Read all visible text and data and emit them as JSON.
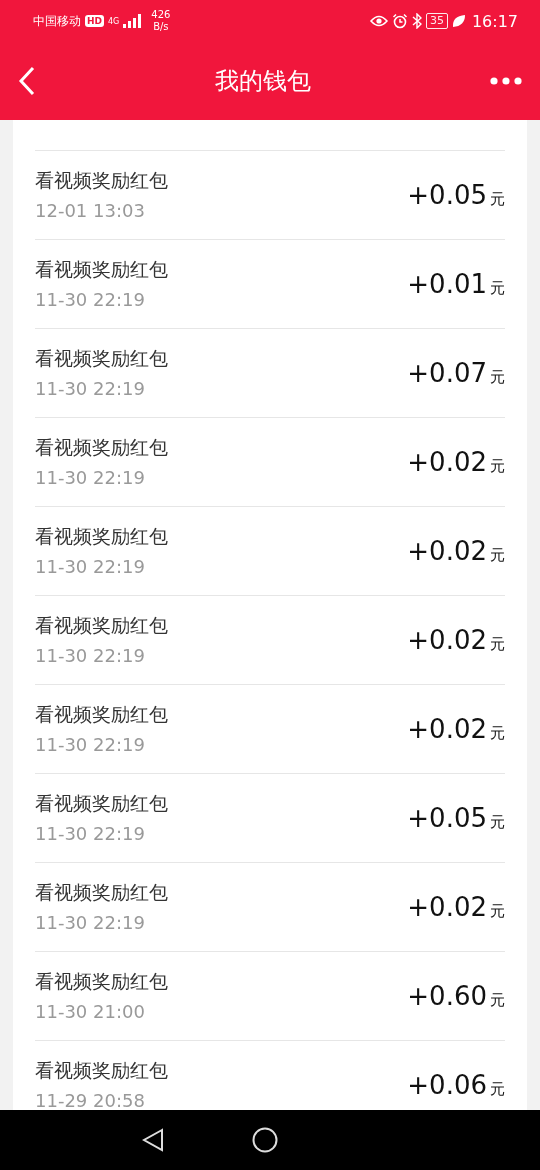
{
  "status_bar": {
    "carrier": "中国移动",
    "hd_badge": "HD",
    "network_type": "4G",
    "speed": "426",
    "speed_unit": "B/s",
    "battery": "35",
    "time": "16:17"
  },
  "header": {
    "title": "我的钱包"
  },
  "transactions": [
    {
      "title": "看视频奖励红包",
      "date": "12-01 13:03",
      "amount": "+0.05",
      "unit": "元"
    },
    {
      "title": "看视频奖励红包",
      "date": "11-30 22:19",
      "amount": "+0.01",
      "unit": "元"
    },
    {
      "title": "看视频奖励红包",
      "date": "11-30 22:19",
      "amount": "+0.07",
      "unit": "元"
    },
    {
      "title": "看视频奖励红包",
      "date": "11-30 22:19",
      "amount": "+0.02",
      "unit": "元"
    },
    {
      "title": "看视频奖励红包",
      "date": "11-30 22:19",
      "amount": "+0.02",
      "unit": "元"
    },
    {
      "title": "看视频奖励红包",
      "date": "11-30 22:19",
      "amount": "+0.02",
      "unit": "元"
    },
    {
      "title": "看视频奖励红包",
      "date": "11-30 22:19",
      "amount": "+0.02",
      "unit": "元"
    },
    {
      "title": "看视频奖励红包",
      "date": "11-30 22:19",
      "amount": "+0.05",
      "unit": "元"
    },
    {
      "title": "看视频奖励红包",
      "date": "11-30 22:19",
      "amount": "+0.02",
      "unit": "元"
    },
    {
      "title": "看视频奖励红包",
      "date": "11-30 21:00",
      "amount": "+0.60",
      "unit": "元"
    },
    {
      "title": "看视频奖励红包",
      "date": "11-29 20:58",
      "amount": "+0.06",
      "unit": "元"
    }
  ]
}
